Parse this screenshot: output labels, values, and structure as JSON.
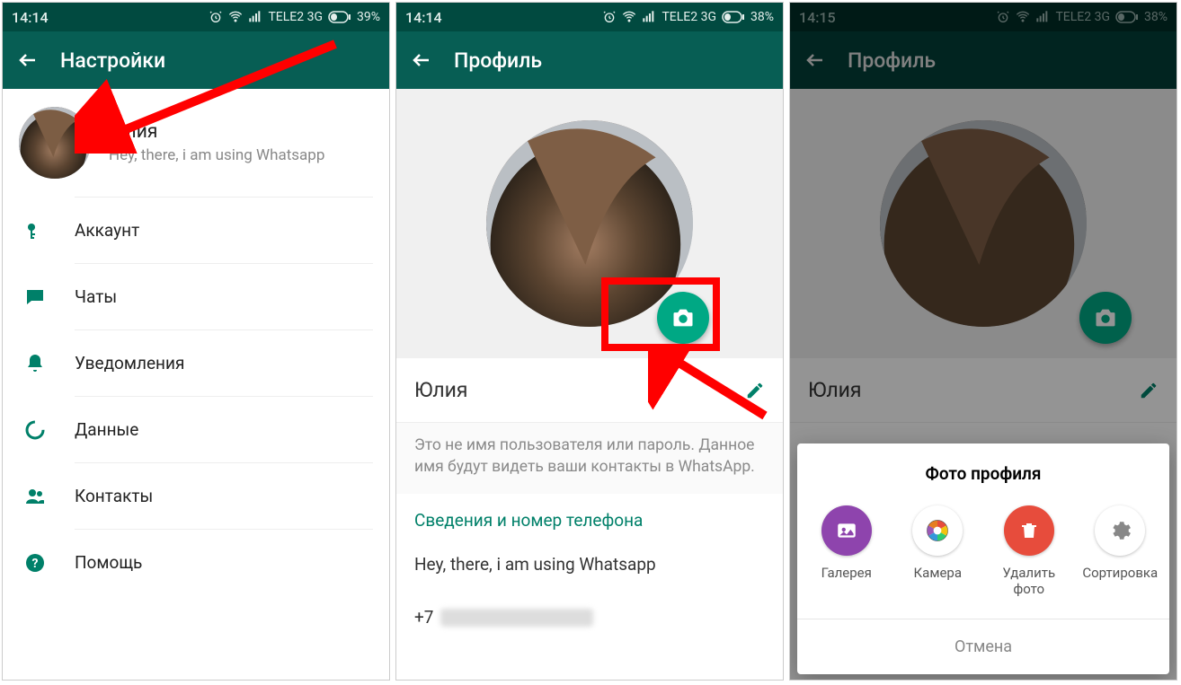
{
  "screen1": {
    "status": {
      "time": "14:14",
      "carrier": "TELE2 3G",
      "battery": "39%"
    },
    "header": {
      "title": "Настройки"
    },
    "profile": {
      "name": "Юлия",
      "status": "Hey, there, i am using Whatsapp"
    },
    "items": [
      {
        "label": "Аккаунт"
      },
      {
        "label": "Чаты"
      },
      {
        "label": "Уведомления"
      },
      {
        "label": "Данные"
      },
      {
        "label": "Контакты"
      },
      {
        "label": "Помощь"
      }
    ]
  },
  "screen2": {
    "status": {
      "time": "14:14",
      "carrier": "TELE2 3G",
      "battery": "38%"
    },
    "header": {
      "title": "Профиль"
    },
    "name": "Юлия",
    "hint": "Это не имя пользователя или пароль. Данное имя будут видеть ваши контакты в WhatsApp.",
    "section": "Сведения и номер телефона",
    "about": "Hey, there, i am using Whatsapp",
    "phone_prefix": "+7"
  },
  "screen3": {
    "status": {
      "time": "14:15",
      "carrier": "TELE2 3G",
      "battery": "38%"
    },
    "header": {
      "title": "Профиль"
    },
    "name": "Юлия",
    "sheet": {
      "title": "Фото профиля",
      "options": [
        {
          "label": "Галерея"
        },
        {
          "label": "Камера"
        },
        {
          "label": "Удалить фото"
        },
        {
          "label": "Сортировка"
        }
      ],
      "cancel": "Отмена"
    }
  }
}
